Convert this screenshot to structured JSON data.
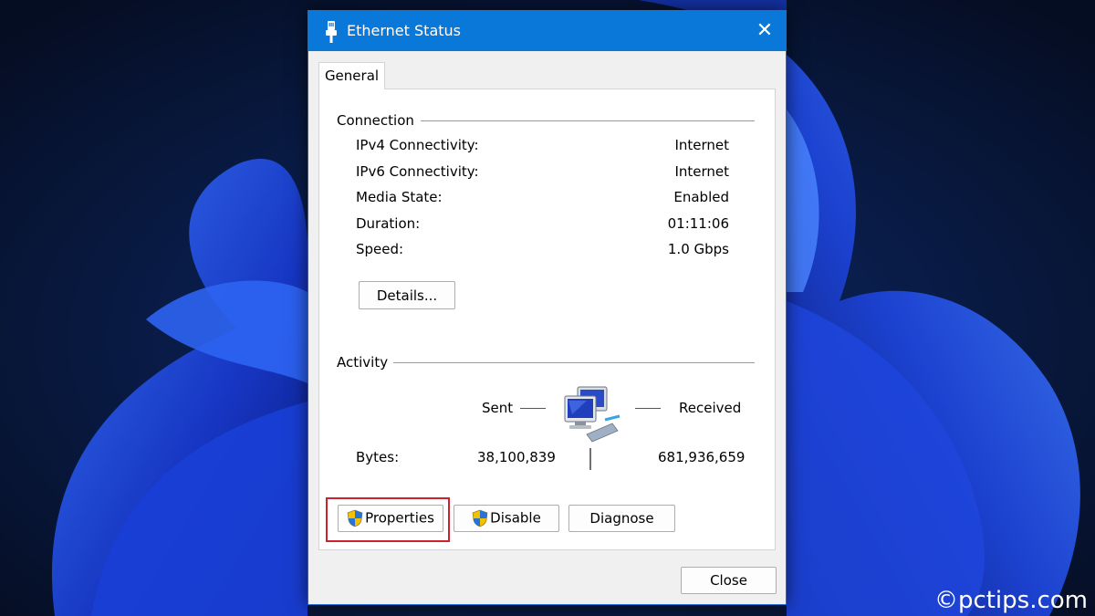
{
  "window": {
    "title": "Ethernet Status",
    "close_glyph": "✕",
    "icon": "ethernet-plug-icon"
  },
  "tabs": [
    {
      "label": "General",
      "selected": true
    }
  ],
  "connection": {
    "heading": "Connection",
    "rows": [
      {
        "label": "IPv4 Connectivity:",
        "value": "Internet"
      },
      {
        "label": "IPv6 Connectivity:",
        "value": "Internet"
      },
      {
        "label": "Media State:",
        "value": "Enabled"
      },
      {
        "label": "Duration:",
        "value": "01:11:06"
      },
      {
        "label": "Speed:",
        "value": "1.0 Gbps"
      }
    ],
    "details_button": "Details..."
  },
  "activity": {
    "heading": "Activity",
    "sent_label": "Sent",
    "received_label": "Received",
    "bytes_label": "Bytes:",
    "bytes_sent": "38,100,839",
    "bytes_received": "681,936,659",
    "icon": "network-computers-icon"
  },
  "buttons": {
    "properties": "Properties",
    "disable": "Disable",
    "diagnose": "Diagnose",
    "close": "Close"
  },
  "watermark": "©pctips.com",
  "colors": {
    "titlebar": "#0a78d8",
    "highlight": "#d0202e",
    "wallpaper_dark": "#081634",
    "wallpaper_blue": "#1f4fe0"
  }
}
